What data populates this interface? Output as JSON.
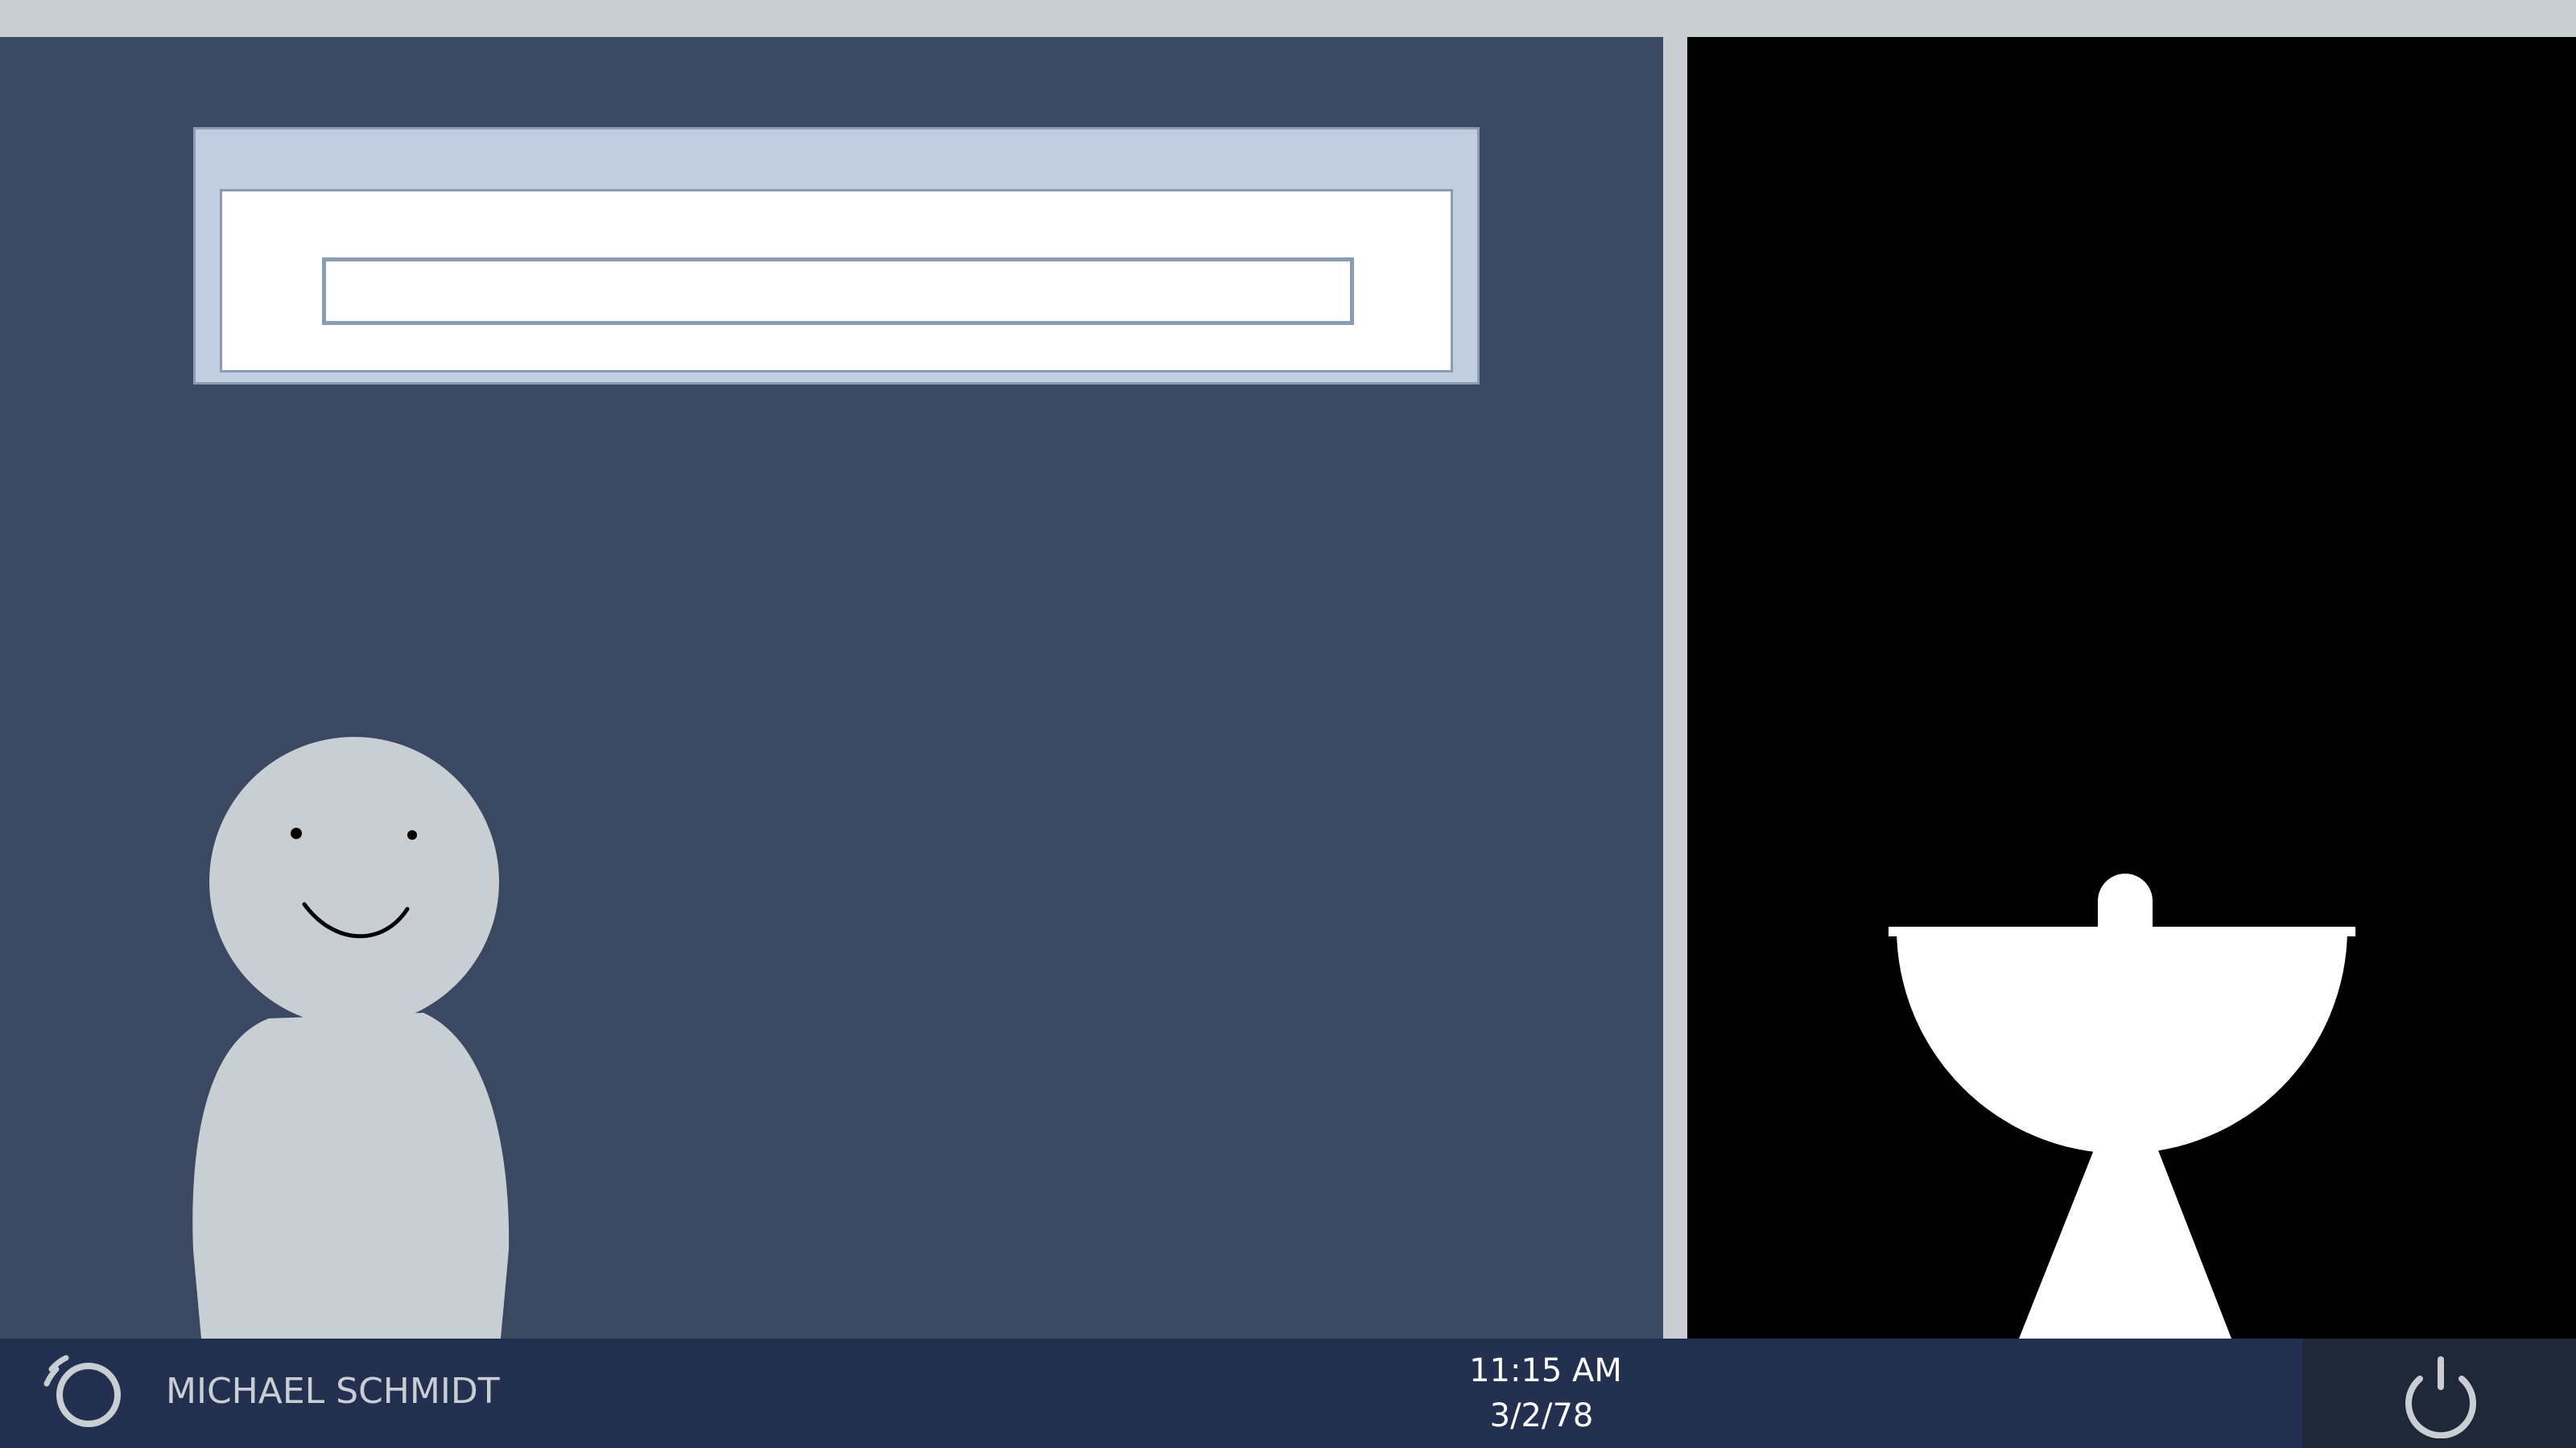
{
  "taskbar": {
    "user_name": "MICHAEL SCHMIDT",
    "time": "11:15 AM",
    "date": "3/2/78",
    "restart_icon": "restart-icon",
    "power_icon": "power-icon"
  },
  "dialog": {
    "input_value": "",
    "input_placeholder": ""
  },
  "icons": {
    "user_avatar": "user-avatar-icon",
    "trophy": "trophy-icon"
  },
  "colors": {
    "left_panel": "#3a4862",
    "right_panel": "#000000",
    "taskbar": "#233050",
    "accent_light": "#c9ced2"
  }
}
